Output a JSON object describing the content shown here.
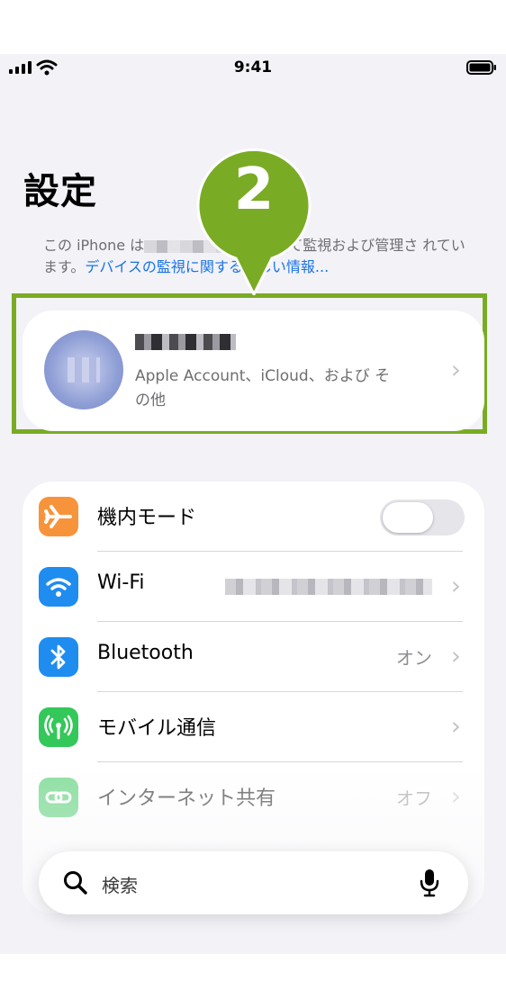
{
  "status": {
    "time": "9:41"
  },
  "page_title": "設定",
  "supervision": {
    "prefix": "この iPhone は",
    "suffix": "て監視および管理さ れています。",
    "link": "デバイスの監視に関する詳しい情報..."
  },
  "marker": {
    "number": "2",
    "color": "#7aab24"
  },
  "account": {
    "subtitle": "Apple Account、iCloud、および その他"
  },
  "settings": {
    "airplane": {
      "label": "機内モード",
      "toggle_on": false
    },
    "wifi": {
      "label": "Wi-Fi"
    },
    "bluetooth": {
      "label": "Bluetooth",
      "value": "オン"
    },
    "cellular": {
      "label": "モバイル通信"
    },
    "hotspot": {
      "label": "インターネット共有",
      "value": "オフ"
    }
  },
  "search": {
    "placeholder": "検索"
  },
  "colors": {
    "airplane": "#f7943b",
    "wifi": "#1f8cf0",
    "bluetooth": "#1f8cf0",
    "cellular": "#34c759",
    "hotspot": "#9fe0a7",
    "link": "#1a73e8"
  }
}
